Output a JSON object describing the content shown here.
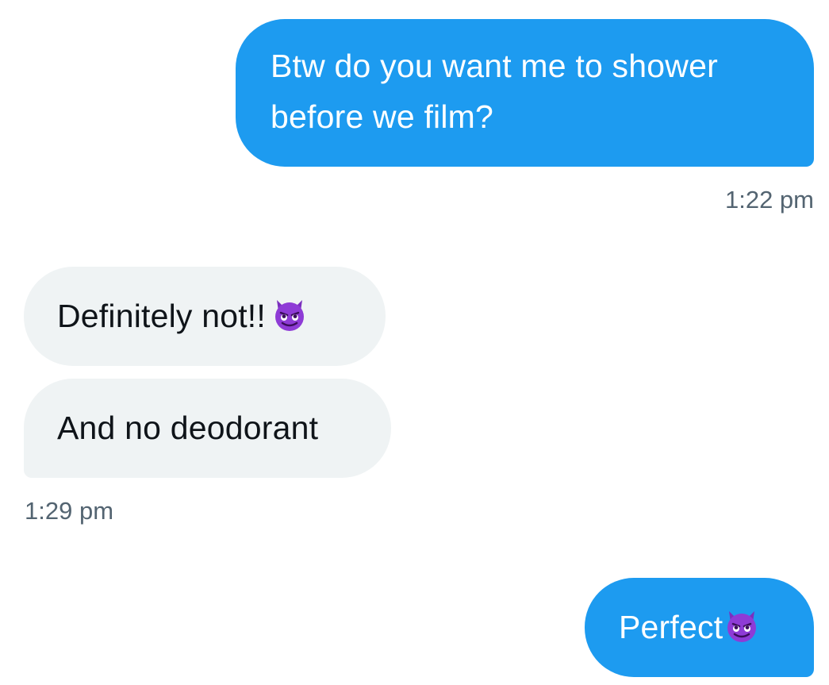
{
  "conversation": {
    "messages": [
      {
        "direction": "outgoing",
        "text": "Btw do you want me to shower before we film?",
        "timestamp": "1:22 pm"
      },
      {
        "direction": "incoming",
        "text": "Definitely not!!",
        "emoji": "smiling-face-with-horns-icon"
      },
      {
        "direction": "incoming",
        "text": "And no deodorant",
        "timestamp": "1:29 pm"
      },
      {
        "direction": "outgoing",
        "text": "Perfect",
        "emoji": "smiling-face-with-horns-icon"
      }
    ]
  },
  "colors": {
    "sent_bubble": "#1d9bf0",
    "received_bubble": "#eff3f4",
    "timestamp_text": "#536471",
    "emoji_purple": "#7b2fbe"
  }
}
